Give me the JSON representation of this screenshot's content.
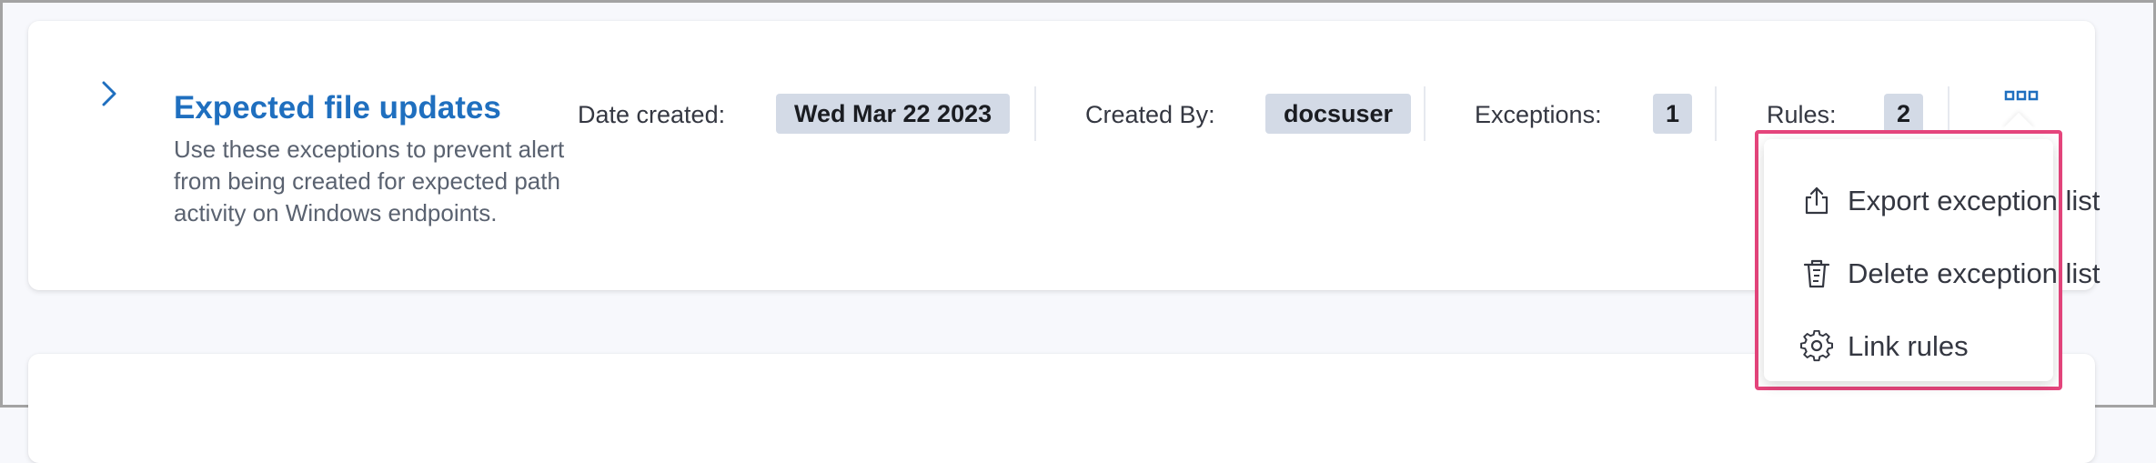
{
  "exception_list": {
    "title": "Expected file updates",
    "description": "Use these exceptions to prevent alert from being created for expected path activity on Windows endpoints.",
    "date_created_label": "Date created:",
    "date_created_value": "Wed Mar 22 2023",
    "created_by_label": "Created By:",
    "created_by_value": "docsuser",
    "exceptions_label": "Exceptions:",
    "exceptions_count": "1",
    "rules_label": "Rules:",
    "rules_count": "2"
  },
  "actions_menu": {
    "items": [
      {
        "label": "Export exception list",
        "icon": "export-icon"
      },
      {
        "label": "Delete exception list",
        "icon": "trash-icon"
      },
      {
        "label": "Link rules",
        "icon": "gear-icon"
      }
    ]
  },
  "colors": {
    "title": "#1f6fbf",
    "badge_bg": "#d3dae6",
    "highlight_border": "#e5457c"
  }
}
